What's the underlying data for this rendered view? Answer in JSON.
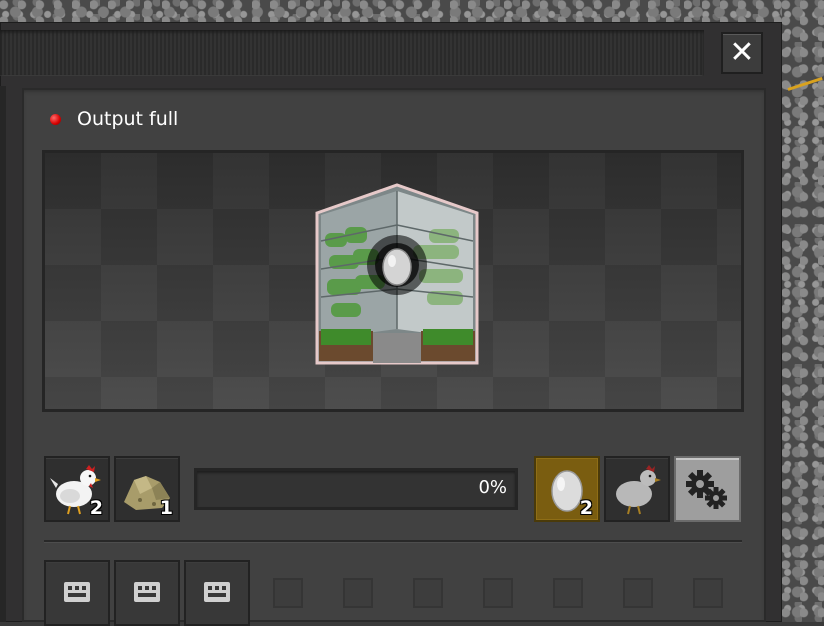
{
  "status": {
    "text": "Output full",
    "color": "#e00000"
  },
  "window": {
    "close_icon": "close-icon"
  },
  "preview": {
    "building": "greenhouse",
    "recipe_icon": "egg-icon"
  },
  "inputs": [
    {
      "item": "chicken",
      "icon": "chicken-icon",
      "count": "2"
    },
    {
      "item": "feed",
      "icon": "feed-pile-icon",
      "count": "1"
    }
  ],
  "progress": {
    "label": "0%",
    "value": 0
  },
  "outputs": [
    {
      "item": "egg",
      "icon": "egg-icon",
      "count": "2",
      "highlight": "#7a5d10"
    },
    {
      "item": "chicken",
      "icon": "chicken-icon",
      "count": ""
    }
  ],
  "settings": {
    "icon": "gears-icon"
  },
  "modules": {
    "filled_slots": 3,
    "icon": "module-slot-icon",
    "empty_slots": 7
  }
}
